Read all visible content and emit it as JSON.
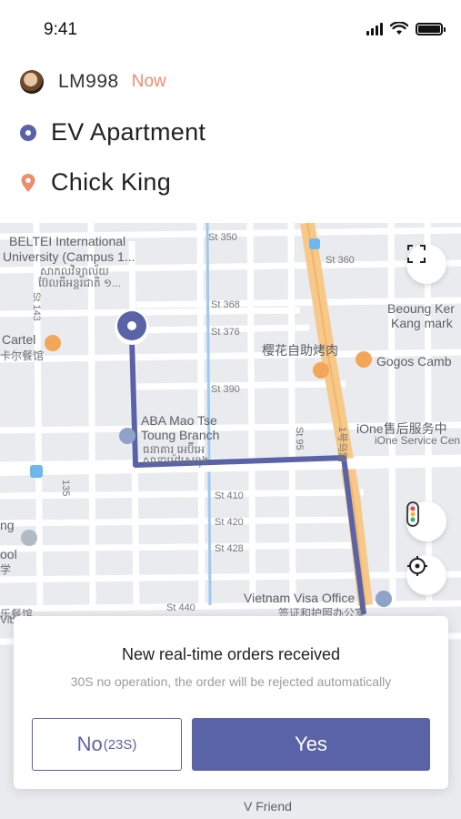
{
  "status": {
    "time": "9:41"
  },
  "driver": {
    "name": "LM998",
    "time": "Now"
  },
  "route": {
    "from": "EV Apartment",
    "to": "Chick King"
  },
  "map": {
    "labels": {
      "beltei": "BELTEI International",
      "beltei2": "University (Campus 1...",
      "beltei_km1": "សាកលវិទ្យាល័យ",
      "beltei_km2": "ប៊ែលធីអន្តរជាតិ ១...",
      "st350": "St 350",
      "st360": "St 360",
      "st368": "St 368",
      "st376": "St 376",
      "st390": "St 390",
      "st410": "St 410",
      "st420": "St 420",
      "st428": "St 428",
      "st440": "St 440",
      "st143": "St 143",
      "st95": "St 95",
      "st135": "135",
      "cartel": "Cartel",
      "cartel_cn": "卡尔餐馆",
      "beoung1": "Beoung Ker",
      "beoung2": "Kang mark",
      "sakura": "樱花自助烤肉",
      "gogos": "Gogos Camb",
      "aba1": "ABA Mao Tse",
      "aba2": "Toung Branch",
      "aba_km1": "ធនាគារ អេប៊ីអេ",
      "aba_km2": "សាខាម៉ៅសេទុង",
      "ione": "iOne售后服务中",
      "ione2": "iOne Service Cen",
      "vietnam": "Vietnam Visa Office",
      "vietnam_cn": "签证和护照办公室",
      "road_cn": "1号马路",
      "left_ng": "ng",
      "left_ool": "ool",
      "left_cn": "学",
      "left_vib": "Vib",
      "left_cn2": "乐餐馆",
      "vfriend": "V Friend"
    }
  },
  "order": {
    "title": "New real-time orders received",
    "subtitle": "30S no operation, the order will be rejected automatically",
    "no_label": "No",
    "no_count": "(23S)",
    "yes_label": "Yes"
  },
  "colors": {
    "accent": "#5b63a8",
    "orange": "#f08c6e",
    "route": "#5b63a8",
    "highway": "#f6c98a"
  },
  "icons": [
    "signal-icon",
    "wifi-icon",
    "battery-icon",
    "origin-dot-icon",
    "destination-pin-icon",
    "fullscreen-icon",
    "traffic-light-icon",
    "locate-icon",
    "origin-marker-icon"
  ]
}
